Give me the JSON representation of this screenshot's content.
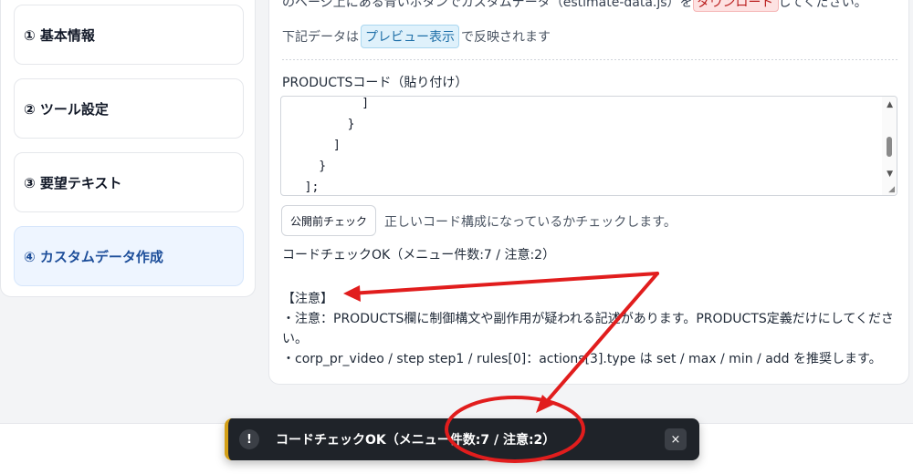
{
  "sidebar": {
    "steps": [
      {
        "label": "① 基本情報"
      },
      {
        "label": "② ツール設定"
      },
      {
        "label": "③ 要望テキスト"
      },
      {
        "label": "④ カスタムデータ作成",
        "active": true
      }
    ]
  },
  "main": {
    "top_line_before": "のページ上にある青いボタンでカスタムデータ（estimate-data.js）を",
    "download_label": "ダウンロード",
    "top_line_after": "してください。",
    "preview_before": "下記データは",
    "preview_label": "プレビュー表示",
    "preview_after": "で反映されます",
    "code_label": "PRODUCTSコード（貼り付け）",
    "code_value": "          ]\n        }\n      ]\n    }\n  ];",
    "check_button": "公開前チェック",
    "check_desc": "正しいコード構成になっているかチェックします。",
    "result": "コードチェックOK（メニュー件数:7 / 注意:2）",
    "notice_heading": "【注意】",
    "notice_1": "・注意：PRODUCTS欄に制御構文や副作用が疑われる記述があります。PRODUCTS定義だけにしてください。",
    "notice_2": "・corp_pr_video / step step1 / rules[0]：actions[3].type は set / max / min / add を推奨します。"
  },
  "toast": {
    "icon": "!",
    "message": "コードチェックOK（メニュー件数:7 / 注意:2）",
    "close": "×"
  },
  "colors": {
    "accent": "#1d4e9a",
    "annotation": "#e11d1d",
    "toast_bg": "#1f2329"
  }
}
